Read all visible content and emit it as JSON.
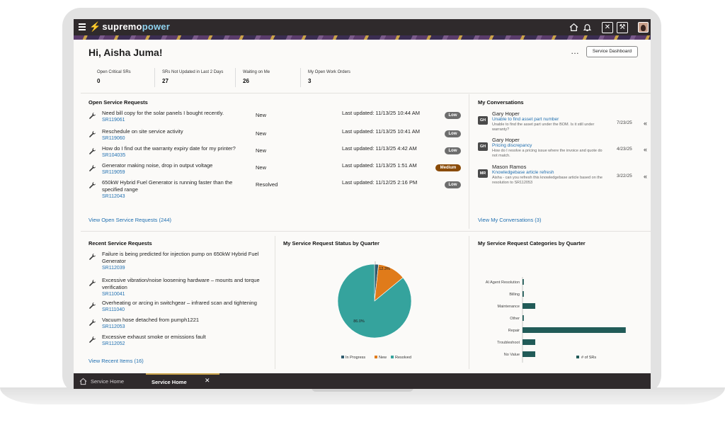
{
  "app": {
    "logo_prefix": "supremo",
    "logo_suffix": "power"
  },
  "topbar_icons": [
    "home-icon",
    "bell-icon",
    "tools-icon",
    "tools-alt-icon",
    "user-avatar"
  ],
  "header": {
    "greeting": "Hi, Aisha Juma!",
    "more": "…",
    "dashboard_button": "Service Dashboard"
  },
  "kpis": [
    {
      "label": "Open Critical SRs",
      "value": "0"
    },
    {
      "label": "SRs Not Updated in Last 2 Days",
      "value": "27"
    },
    {
      "label": "Waiting on Me",
      "value": "26"
    },
    {
      "label": "My Open Work Orders",
      "value": "3"
    }
  ],
  "open_sr": {
    "title": "Open Service Requests",
    "rows": [
      {
        "title": "Need bill copy for the solar panels I bought recently.",
        "id": "SR119061",
        "status": "New",
        "updated": "Last updated: 11/13/25 10:44 AM",
        "priority": "Low"
      },
      {
        "title": "Reschedule on site service activity",
        "id": "SR119060",
        "status": "New",
        "updated": "Last updated: 11/13/25 10:41 AM",
        "priority": "Low"
      },
      {
        "title": "How do I find out the warranty expiry date for my printer?",
        "id": "SR104035",
        "status": "New",
        "updated": "Last updated: 11/13/25 4:42 AM",
        "priority": "Low"
      },
      {
        "title": "Generator making noise, drop in output voltage",
        "id": "SR119059",
        "status": "New",
        "updated": "Last updated: 11/13/25 1:51 AM",
        "priority": "Medium"
      },
      {
        "title": "650kW Hybrid Fuel Generator is running faster than the specified range",
        "id": "SR112043",
        "status": "Resolved",
        "updated": "Last updated: 11/12/25 2:16 PM",
        "priority": "Low"
      }
    ],
    "footer": "View Open Service Requests (244)"
  },
  "conversations": {
    "title": "My Conversations",
    "items": [
      {
        "initials": "GH",
        "name": "Gary Hoper",
        "subject": "Unable to find asset part number",
        "message": "Unable to find the asset part under the BOM. Is it still under warranty?",
        "date": "7/23/25"
      },
      {
        "initials": "GH",
        "name": "Gary Hoper",
        "subject": "Pricing discrepancy",
        "message": "How do I resolve a pricing issue where the invoice and quote do not match.",
        "date": "4/23/25"
      },
      {
        "initials": "MR",
        "name": "Mason Ramos",
        "subject": "Knowledgebase article refresh",
        "message": "Aisha - can you refresh this knowledgebase article based on the resolution to SR112053",
        "date": "3/22/25"
      }
    ],
    "footer": "View My Conversations (3)"
  },
  "recent_sr": {
    "title": "Recent Service Requests",
    "rows": [
      {
        "title": "Failure is being predicted for injection pump on 650kW Hybrid Fuel Generator",
        "id": "SR112039"
      },
      {
        "title": "Excessive vibration/noise loosening hardware – mounts and torque verification",
        "id": "SR110041"
      },
      {
        "title": "Overheating or arcing in switchgear – infrared scan and tightening",
        "id": "SR111040"
      },
      {
        "title": "Vacuum hose detached from pumph1221",
        "id": "SR112053"
      },
      {
        "title": "Excessive exhaust smoke or emissions fault",
        "id": "SR112052"
      }
    ],
    "footer": "View Recent Items (16)"
  },
  "chart_data": [
    {
      "type": "pie",
      "title": "My Service Request Status by Quarter",
      "categories": [
        "In Progress",
        "New",
        "Resolved"
      ],
      "values": [
        1.75,
        12.3,
        86.0
      ],
      "labels": [
        "1.75%",
        "12.3%",
        "86.0%"
      ],
      "colors": [
        "#2f5b6e",
        "#e07b1a",
        "#35a39d"
      ],
      "legend": "bottom"
    },
    {
      "type": "bar",
      "orientation": "horizontal",
      "title": "My Service Request Categories by Quarter",
      "categories": [
        "AI Agent Resolution",
        "Billing",
        "Maintenance",
        "Other",
        "Repair",
        "Troubleshoot",
        "No Value"
      ],
      "values": [
        1,
        1,
        10,
        1,
        81,
        10,
        10
      ],
      "xlim": [
        0,
        100
      ],
      "xticks": [
        0,
        20,
        40,
        60,
        80,
        100
      ],
      "series_name": "# of SRs",
      "color": "#215b58",
      "legend": "bottom"
    }
  ],
  "tabs": [
    {
      "label": "Service Home"
    },
    {
      "label": "Service Home",
      "close": "✕"
    }
  ]
}
